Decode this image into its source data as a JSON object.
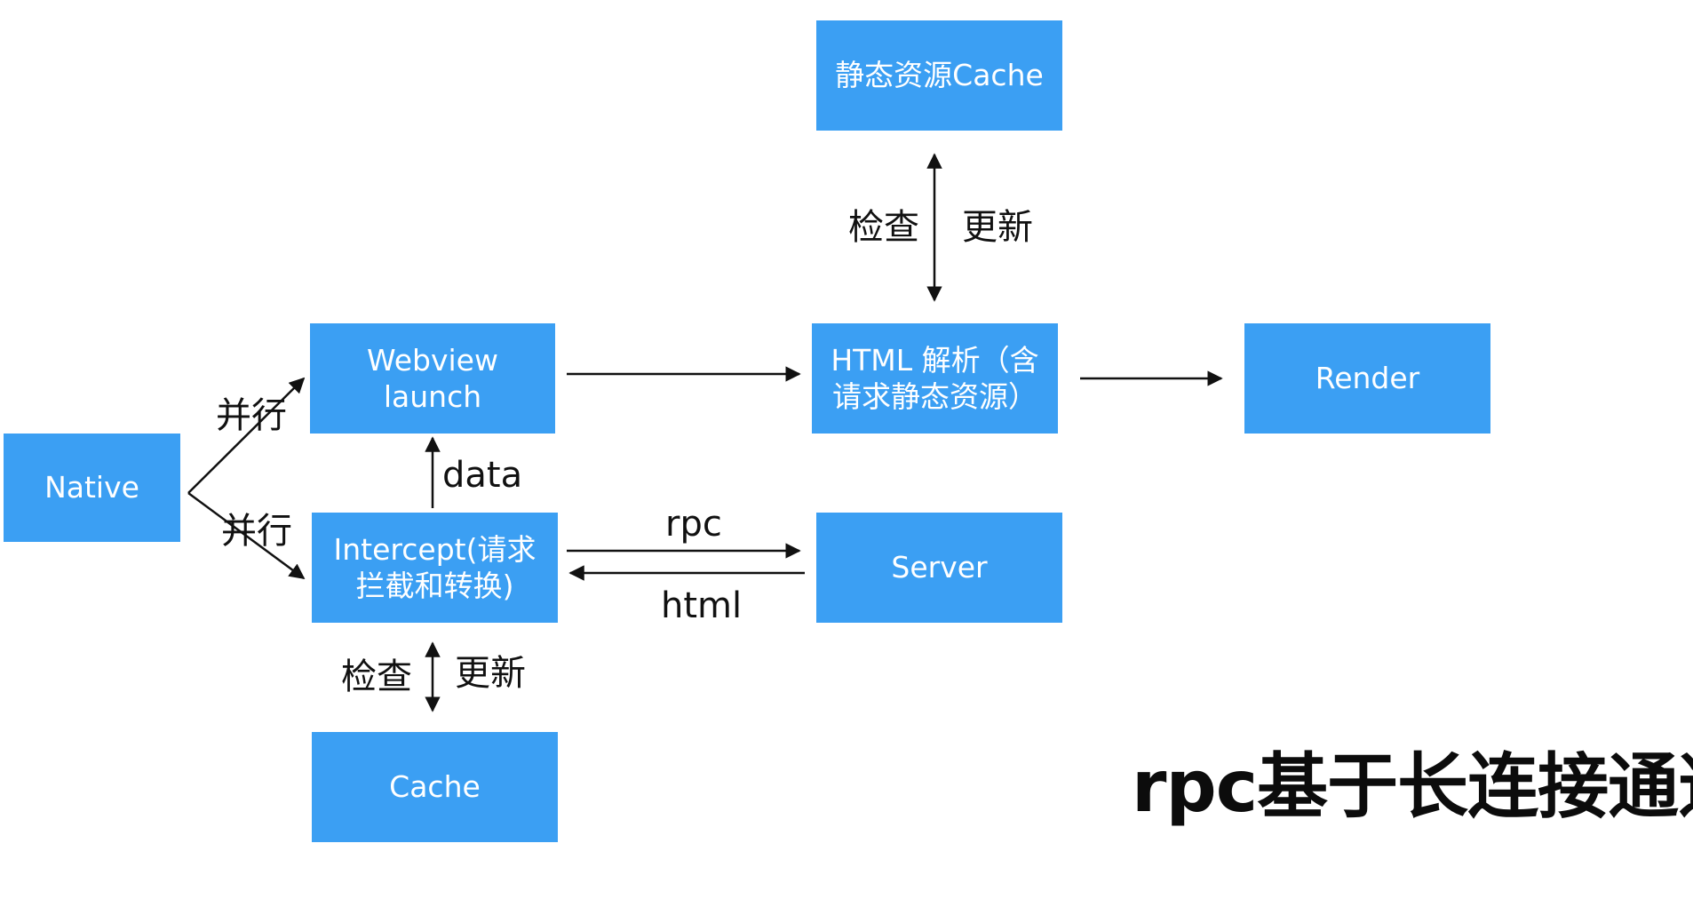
{
  "colors": {
    "box_fill": "#3b9ff3",
    "box_text": "#ffffff",
    "line": "#111111"
  },
  "nodes": {
    "static_cache": "静态资源Cache",
    "webview": "Webview launch",
    "html_parse": "HTML 解析（含请求静态资源）",
    "render": "Render",
    "native": "Native",
    "intercept": "Intercept(请求拦截和转换)",
    "server": "Server",
    "cache": "Cache"
  },
  "edge_labels": {
    "parallel_top": "并行",
    "parallel_bottom": "并行",
    "data": "data",
    "rpc": "rpc",
    "html": "html",
    "check_top": "检查",
    "update_top": "更新",
    "check_bottom": "检查",
    "update_bottom": "更新"
  },
  "footnote": "rpc基于长连接通道"
}
